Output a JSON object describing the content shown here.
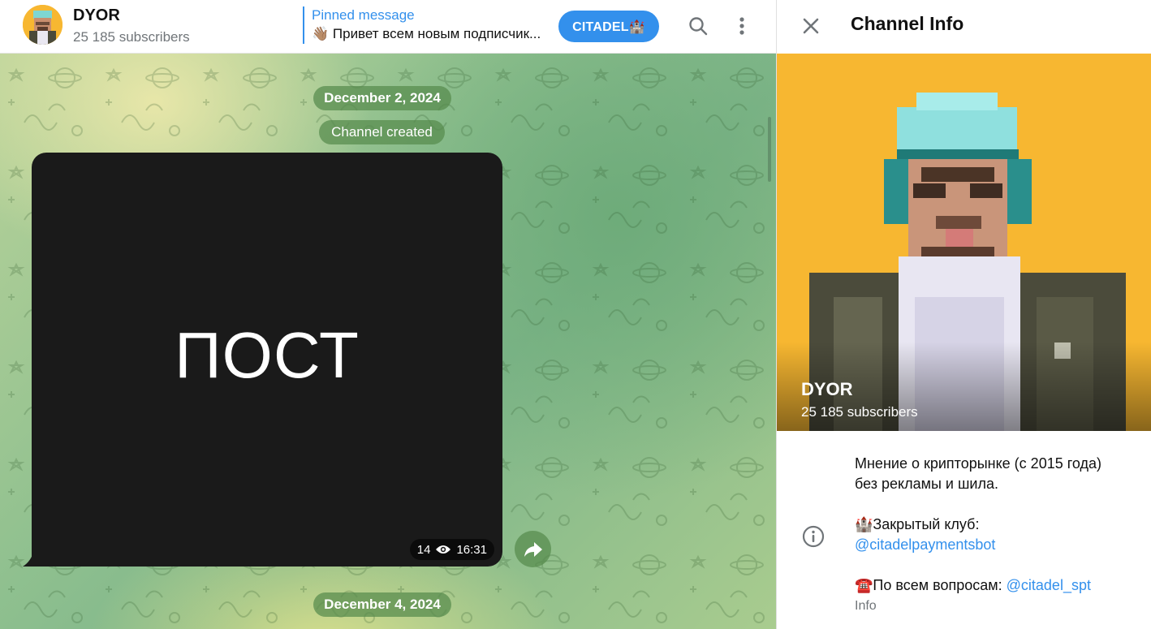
{
  "chat": {
    "title": "DYOR",
    "subscribers": "25 185 subscribers",
    "pinned": {
      "label": "Pinned message",
      "text": "👋🏽 Привет всем новым подписчик..."
    },
    "join_button": "CITADEL🏰",
    "icons": {
      "search": "search-icon",
      "more": "more-vertical-icon"
    }
  },
  "feed": {
    "date_1": "December 2, 2024",
    "service_message": "Channel created",
    "post": {
      "text": "ПОСТ",
      "views": "14",
      "time": "16:31"
    },
    "date_2": "December 4, 2024",
    "share_icon": "share-icon"
  },
  "info_panel": {
    "title": "Channel Info",
    "close_icon": "close-icon",
    "photo_name": "DYOR",
    "photo_subscribers": "25 185 subscribers",
    "description_line_1": "Мнение о крипторынке (с 2015 года)",
    "description_line_2": "без рекламы и шила.",
    "club_text": "🏰Закрытый клуб:",
    "club_link": "@citadelpaymentsbot",
    "contact_text": "☎️По всем вопросам: ",
    "contact_link": "@citadel_spt",
    "section_label": "Info",
    "info_icon": "info-icon"
  },
  "colors": {
    "accent": "#3390ec",
    "photo_bg": "#f7b731",
    "post_bg": "#1a1a1a",
    "pill_bg": "#568a4c"
  }
}
